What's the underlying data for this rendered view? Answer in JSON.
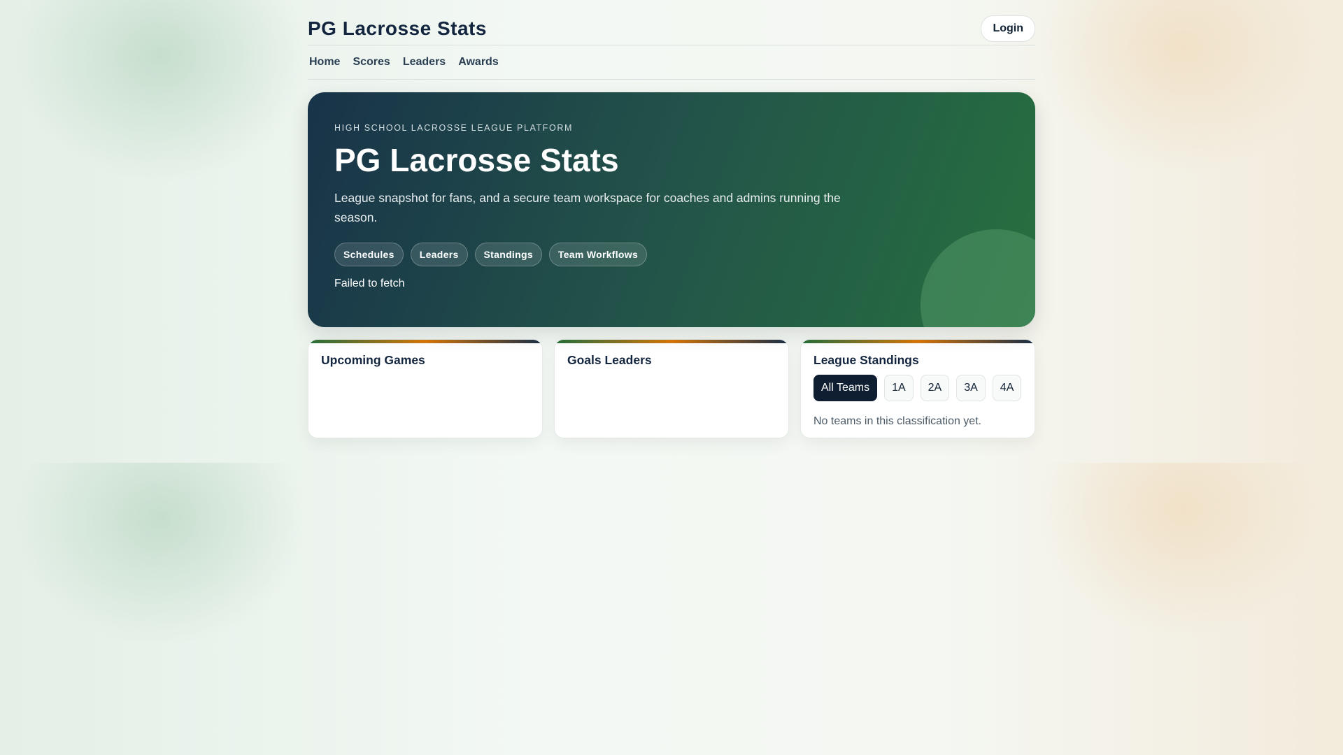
{
  "header": {
    "brand": "PG Lacrosse Stats",
    "login": "Login"
  },
  "nav": [
    "Home",
    "Scores",
    "Leaders",
    "Awards"
  ],
  "hero": {
    "eyebrow": "HIGH SCHOOL LACROSSE LEAGUE PLATFORM",
    "title": "PG Lacrosse Stats",
    "description": "League snapshot for fans, and a secure team workspace for coaches and admins running the season.",
    "chips": [
      "Schedules",
      "Leaders",
      "Standings",
      "Team Workflows"
    ],
    "status": "Failed to fetch"
  },
  "cards": {
    "upcoming": "Upcoming Games",
    "goals": "Goals Leaders",
    "standings": {
      "title": "League Standings",
      "filters": [
        "All Teams",
        "1A",
        "2A",
        "3A",
        "4A"
      ],
      "empty": "No teams in this classification yet."
    }
  }
}
